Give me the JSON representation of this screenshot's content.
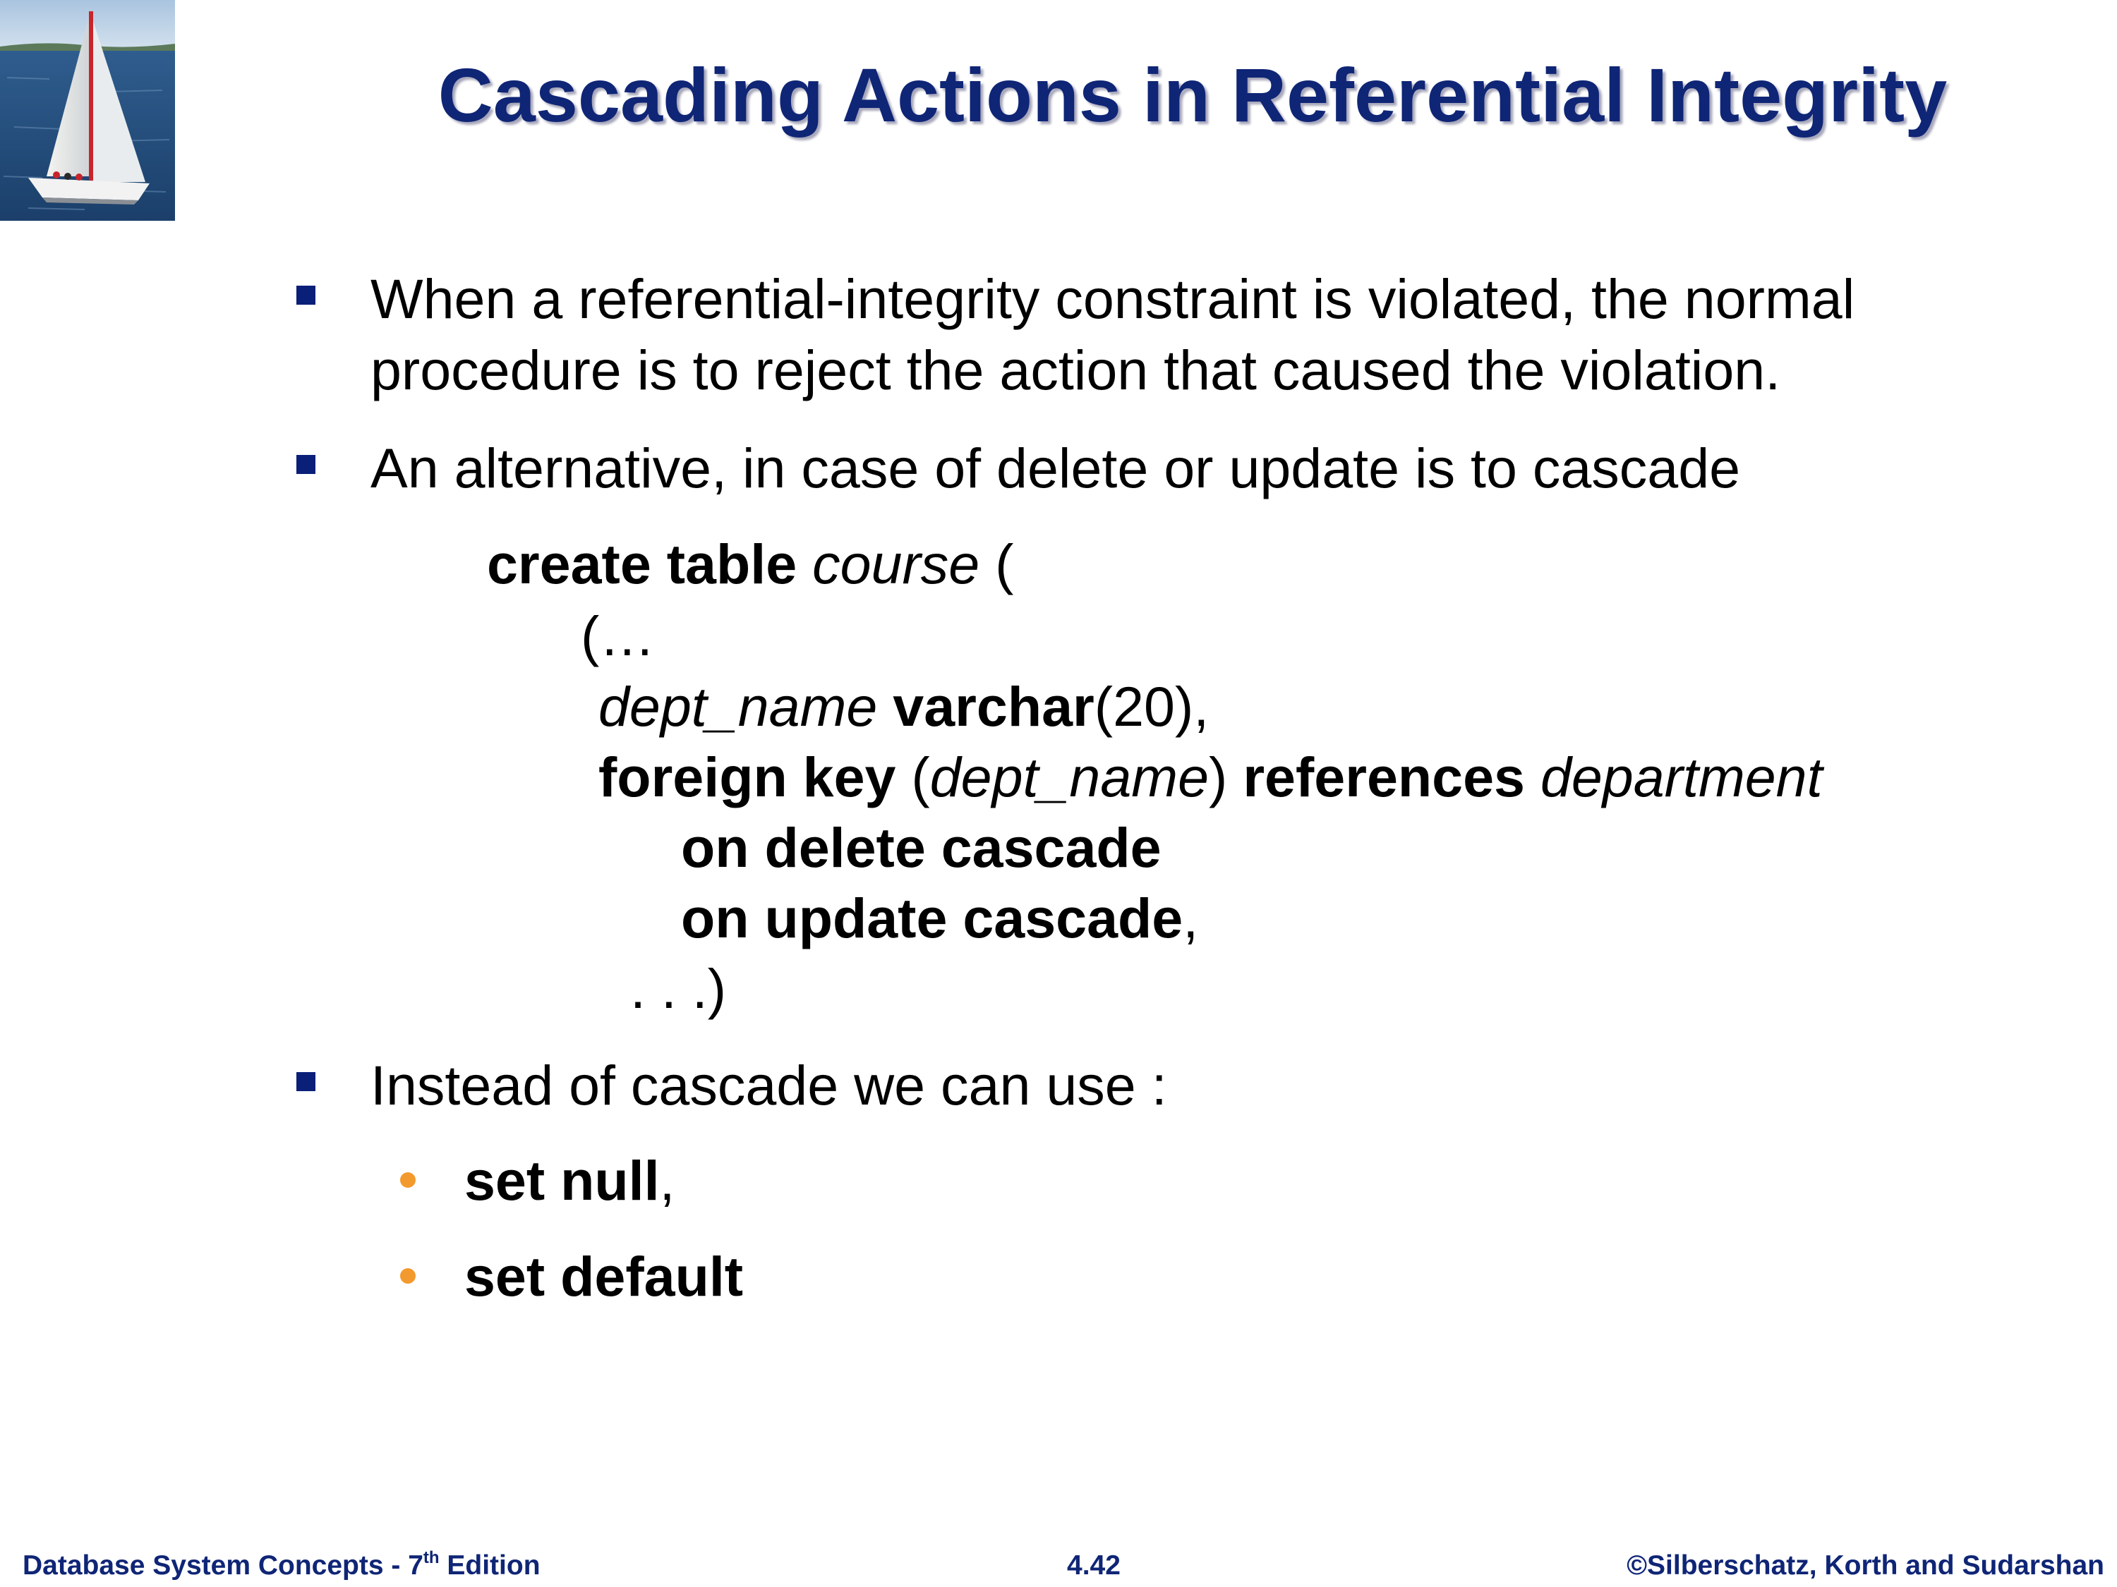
{
  "slide": {
    "title": "Cascading Actions in Referential Integrity"
  },
  "bullets": [
    {
      "line1": "When a referential-integrity constraint is violated, the normal",
      "line2": "procedure is to reject the action that caused the violation."
    },
    {
      "line1": "An alternative, in case of delete or update is to cascade"
    },
    {
      "line1": "Instead of cascade we can use :"
    }
  ],
  "code": {
    "line1": {
      "kw": "create table",
      "name": "course",
      "rest": " ("
    },
    "line2": "(…",
    "line3": {
      "attr": "dept_name",
      "type": "varchar",
      "args": "(20),"
    },
    "line4": {
      "kw1": "foreign key",
      "open": " (",
      "attr": "dept_name",
      "close": ") ",
      "kw2": "references",
      "table": "department"
    },
    "line5": "on delete cascade",
    "line6": {
      "kw": "on update cascade",
      "rest": ","
    },
    "line7": ". . .)"
  },
  "sub_bullets": [
    {
      "kw": "set null",
      "rest": ","
    },
    {
      "kw": "set default",
      "rest": ""
    }
  ],
  "footer": {
    "book": "Database System Concepts - 7",
    "edition_sup": "th",
    "edition": " Edition",
    "page": "4.42",
    "copyright": "©Silberschatz, Korth and Sudarshan"
  },
  "colors": {
    "title": "#0f2576",
    "bullet_square": "#0a1f78",
    "bullet_dot": "#f39a2e",
    "footer": "#0f2576"
  },
  "icons": {
    "logo": "sailboat-image-icon"
  }
}
